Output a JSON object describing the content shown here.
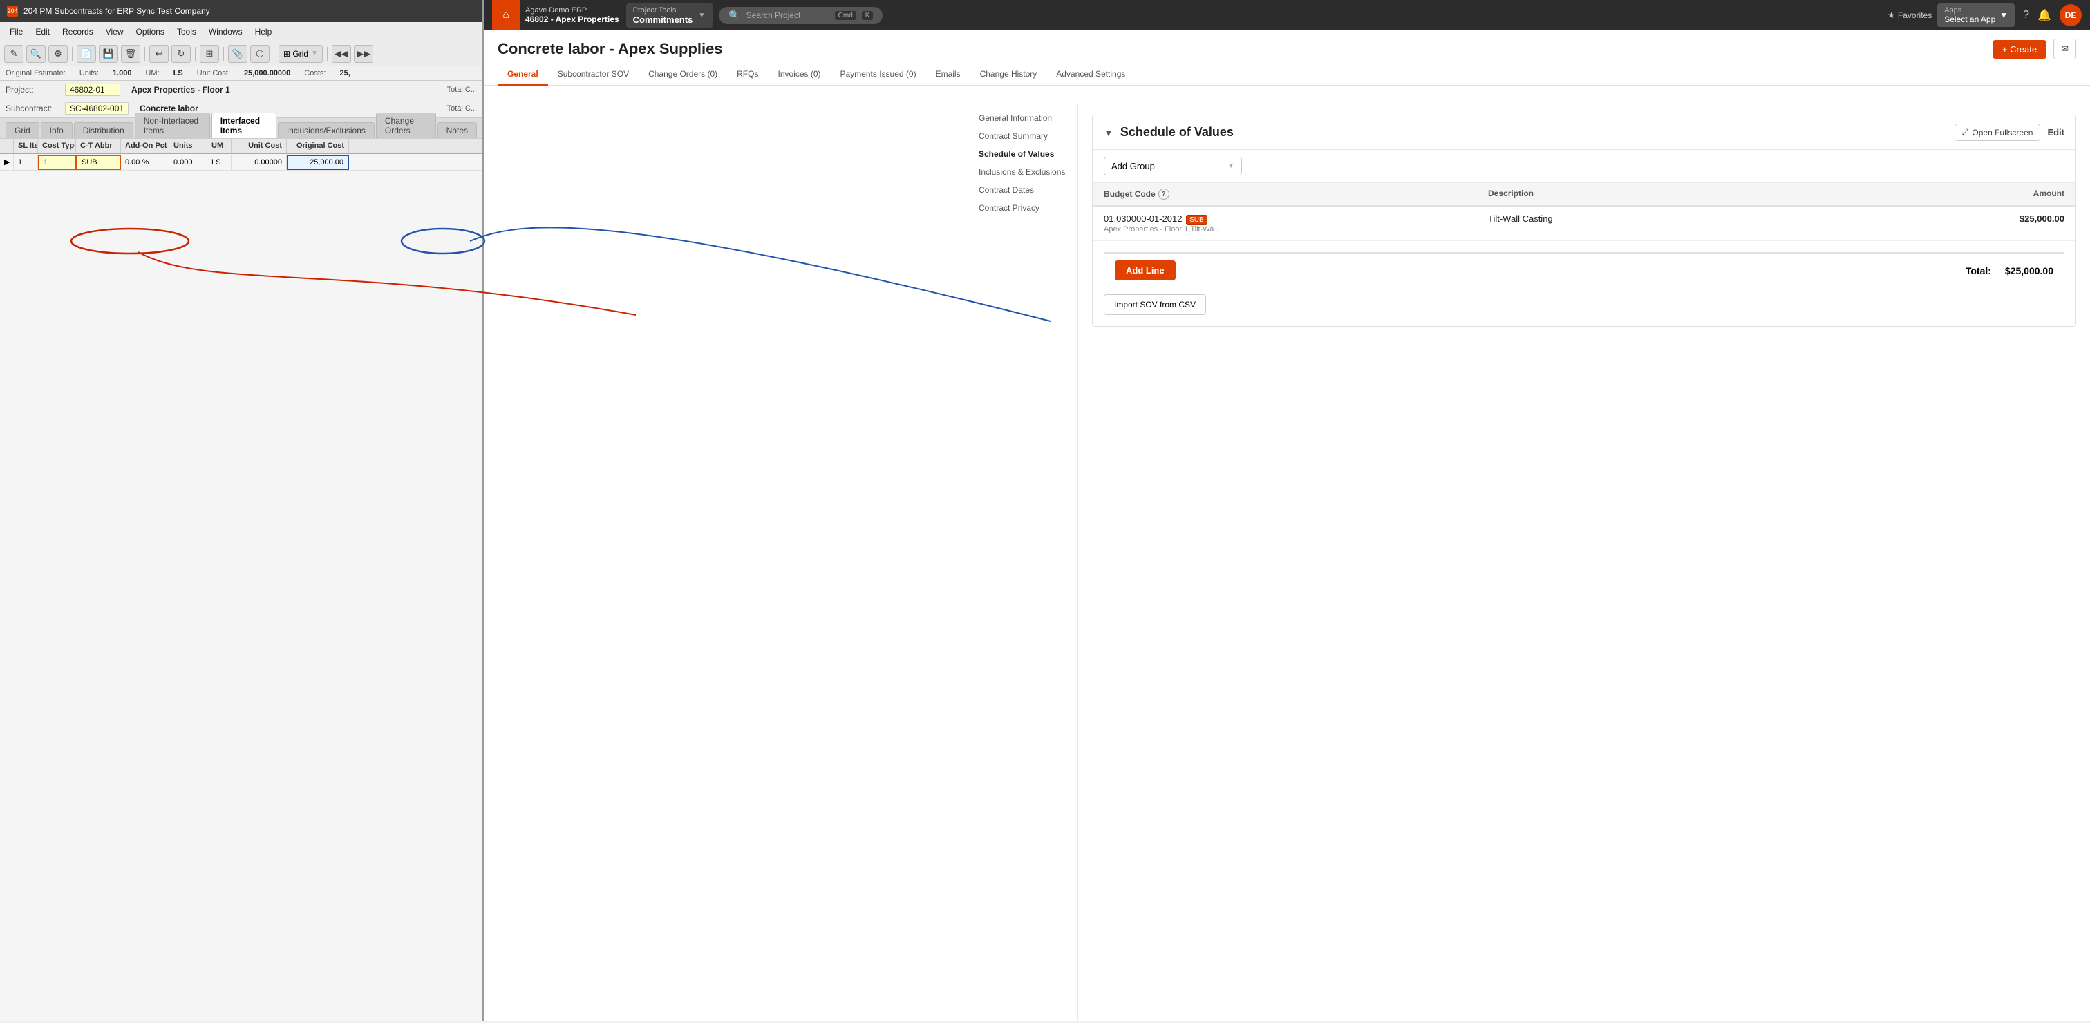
{
  "app": {
    "title": "204 PM Subcontracts for ERP Sync Test Company",
    "icon": "204"
  },
  "left_panel": {
    "menu": [
      "File",
      "Edit",
      "Records",
      "View",
      "Options",
      "Tools",
      "Windows",
      "Help"
    ],
    "info_bar": {
      "original_estimate_label": "Original Estimate:",
      "units_label": "Units:",
      "units_value": "1.000",
      "um_label": "UM:",
      "um_value": "LS",
      "unit_cost_label": "Unit Cost:",
      "unit_cost_value": "25,000.00000",
      "costs_label": "Costs:",
      "costs_value": "25,"
    },
    "project_bar": {
      "project_label": "Project:",
      "project_number": "46802-01",
      "project_name": "Apex Properties - Floor 1",
      "subcontract_label": "Subcontract:",
      "subcontract_number": "SC-46802-001",
      "subcontract_name": "Concrete labor"
    },
    "tabs": [
      "Grid",
      "Info",
      "Distribution",
      "Non-Interfaced Items",
      "Interfaced Items",
      "Inclusions/Exclusions",
      "Change Orders",
      "Notes"
    ],
    "active_tab": "Interfaced Items",
    "grid_columns": [
      {
        "key": "arrow",
        "label": "",
        "width": 20
      },
      {
        "key": "sl_item",
        "label": "SL Item",
        "width": 35
      },
      {
        "key": "cost_type",
        "label": "Cost Type",
        "width": 55
      },
      {
        "key": "ct_abbr",
        "label": "C-T Abbr",
        "width": 65
      },
      {
        "key": "addon_pct",
        "label": "Add-On Pct",
        "width": 70
      },
      {
        "key": "units",
        "label": "Units",
        "width": 55
      },
      {
        "key": "um",
        "label": "UM",
        "width": 35
      },
      {
        "key": "unit_cost",
        "label": "Unit Cost",
        "width": 80
      },
      {
        "key": "original_cost",
        "label": "Original Cost",
        "width": 90
      }
    ],
    "grid_rows": [
      {
        "sl_item": "1",
        "cost_type": "1",
        "ct_abbr": "SUB",
        "addon_pct": "0.00 %",
        "units": "0.000",
        "um": "LS",
        "unit_cost": "0.00000",
        "original_cost": "25,000.00"
      }
    ]
  },
  "right_panel": {
    "nav": {
      "home_icon": "⌂",
      "company_name": "Agave Demo ERP",
      "project_number": "46802",
      "project_name": "Apex Properties",
      "module": "Project Tools",
      "sub_module": "Commitments",
      "search_placeholder": "Search Project",
      "search_shortcut_cmd": "Cmd",
      "search_shortcut_key": "K",
      "favorites_label": "Favorites",
      "apps_label": "Apps",
      "apps_sub": "Select an App",
      "avatar": "DE"
    },
    "page_title": "Concrete labor - Apex Supplies",
    "create_button": "+ Create",
    "content_tabs": [
      {
        "label": "General",
        "active": true
      },
      {
        "label": "Subcontractor SOV",
        "active": false
      },
      {
        "label": "Change Orders (0)",
        "active": false
      },
      {
        "label": "RFQs",
        "active": false
      },
      {
        "label": "Invoices (0)",
        "active": false
      },
      {
        "label": "Payments Issued (0)",
        "active": false
      },
      {
        "label": "Emails",
        "active": false
      },
      {
        "label": "Change History",
        "active": false
      },
      {
        "label": "Advanced Settings",
        "active": false
      }
    ],
    "sidebar_links": [
      {
        "label": "General Information",
        "active": false
      },
      {
        "label": "Contract Summary",
        "active": false
      },
      {
        "label": "Schedule of Values",
        "active": true
      },
      {
        "label": "Inclusions & Exclusions",
        "active": false
      },
      {
        "label": "Contract Dates",
        "active": false
      },
      {
        "label": "Contract Privacy",
        "active": false
      }
    ],
    "sov": {
      "title": "Schedule of Values",
      "collapse_icon": "▼",
      "fullscreen_label": "Open Fullscreen",
      "edit_label": "Edit",
      "add_group_placeholder": "Add Group",
      "table_headers": {
        "budget_code": "Budget Code",
        "description": "Description",
        "amount": "Amount"
      },
      "rows": [
        {
          "budget_code": "01.030000-01-2012",
          "budget_code_tag": "SUB",
          "budget_subtext": "Apex Properties - Floor 1,Tilt-Wa...",
          "description": "Tilt-Wall Casting",
          "amount": "$25,000.00"
        }
      ],
      "add_line_label": "Add Line",
      "total_label": "Total:",
      "total_value": "$25,000.00",
      "import_label": "Import SOV from CSV"
    }
  }
}
